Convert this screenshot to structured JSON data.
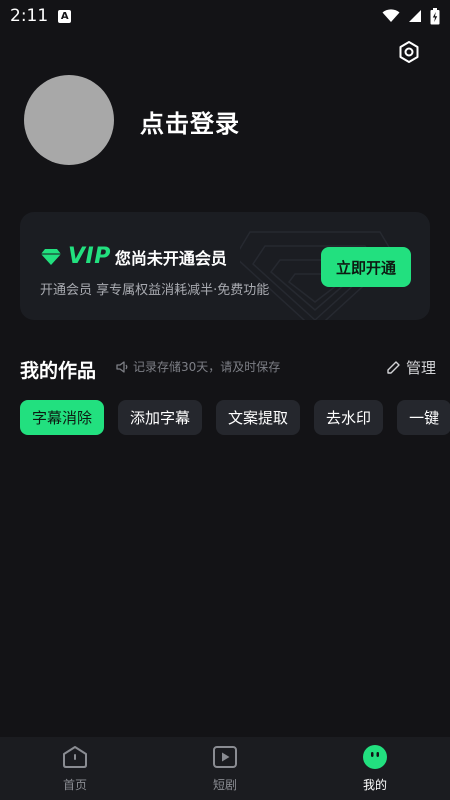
{
  "status_bar": {
    "time": "2:11",
    "app_badge": "A"
  },
  "profile": {
    "login_text": "点击登录"
  },
  "vip_card": {
    "vip_word": "VIP",
    "status": "您尚未开通会员",
    "description": "开通会员 享专属权益消耗减半·免费功能",
    "button_label": "立即开通",
    "accent_color": "#22e07f"
  },
  "works": {
    "title": "我的作品",
    "notice": "记录存储30天，请及时保存",
    "manage_label": "管理",
    "chips": [
      {
        "label": "字幕消除",
        "active": true
      },
      {
        "label": "添加字幕",
        "active": false
      },
      {
        "label": "文案提取",
        "active": false
      },
      {
        "label": "去水印",
        "active": false
      },
      {
        "label": "一键",
        "active": false
      }
    ]
  },
  "bottom_nav": {
    "items": [
      {
        "label": "首页",
        "icon": "home-icon",
        "active": false
      },
      {
        "label": "短剧",
        "icon": "play-icon",
        "active": false
      },
      {
        "label": "我的",
        "icon": "profile-face-icon",
        "active": true
      }
    ]
  }
}
